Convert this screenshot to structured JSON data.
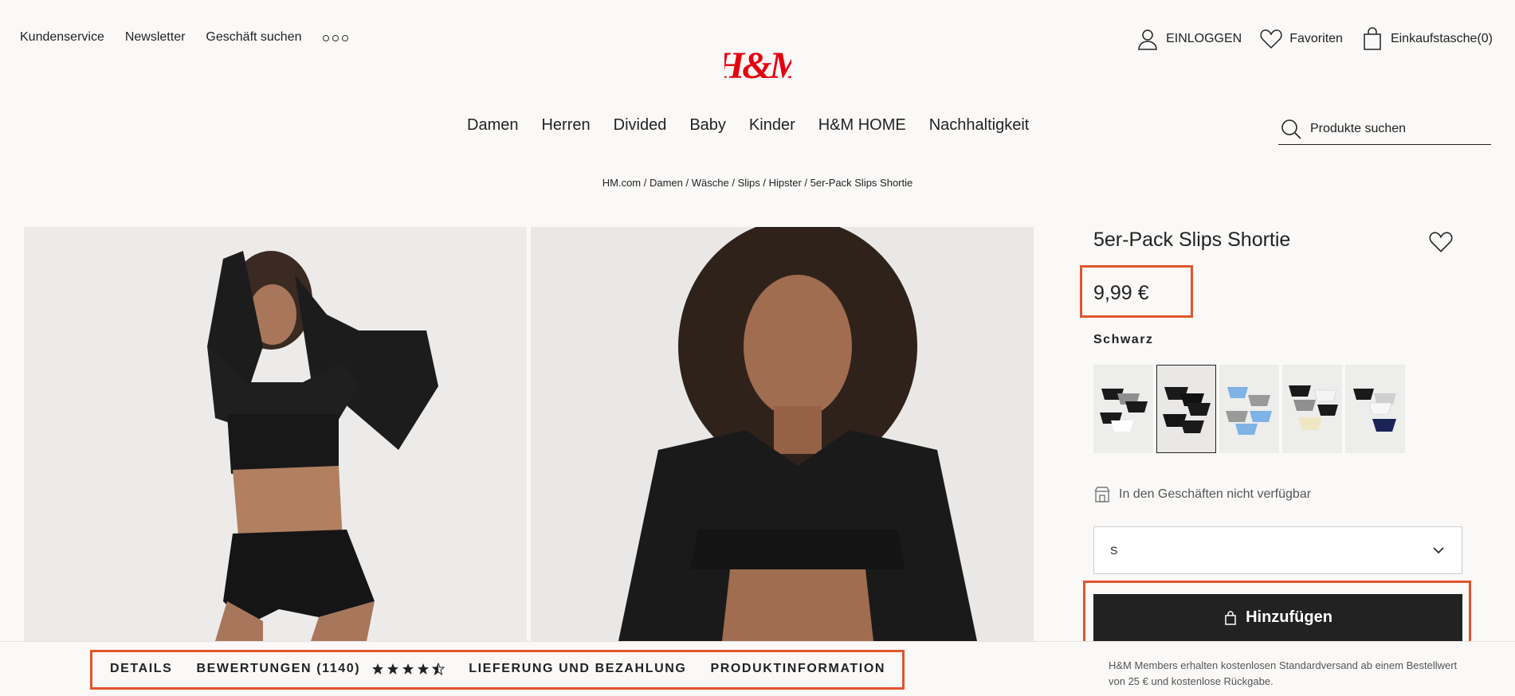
{
  "utility": {
    "left": [
      "Kundenservice",
      "Newsletter",
      "Geschäft suchen"
    ],
    "login": "EINLOGGEN",
    "favorites": "Favoriten",
    "bag": "Einkaufstasche(0)"
  },
  "logo": "H&M",
  "nav": [
    "Damen",
    "Herren",
    "Divided",
    "Baby",
    "Kinder",
    "H&M HOME",
    "Nachhaltigkeit"
  ],
  "search": {
    "placeholder": "Produkte suchen"
  },
  "breadcrumb": [
    "HM.com",
    "Damen",
    "Wäsche",
    "Slips",
    "Hipster",
    "5er-Pack Slips Shortie"
  ],
  "product": {
    "title": "5er-Pack Slips Shortie",
    "price": "9,99 €",
    "color": "Schwarz",
    "availability": "In den Geschäften nicht verfügbar",
    "size": "S",
    "add_label": "Hinzufügen",
    "members_note": "H&M Members erhalten kostenlosen Standardversand ab einem Bestellwert von 25 € und kostenlose Rückgabe.",
    "swatches": [
      {
        "name": "black-grey-white",
        "selected": false
      },
      {
        "name": "black",
        "selected": true
      },
      {
        "name": "light-blue-grey",
        "selected": false
      },
      {
        "name": "black-beige-white",
        "selected": false
      },
      {
        "name": "black-white-navy",
        "selected": false
      }
    ]
  },
  "tabs": {
    "details": "DETAILS",
    "reviews": "BEWERTUNGEN (1140)",
    "rating": 4.5,
    "delivery": "LIEFERUNG UND BEZAHLUNG",
    "info": "PRODUKTINFORMATION"
  },
  "colors": {
    "brand": "#e50010",
    "highlight": "#e2542b",
    "button": "#222222"
  }
}
